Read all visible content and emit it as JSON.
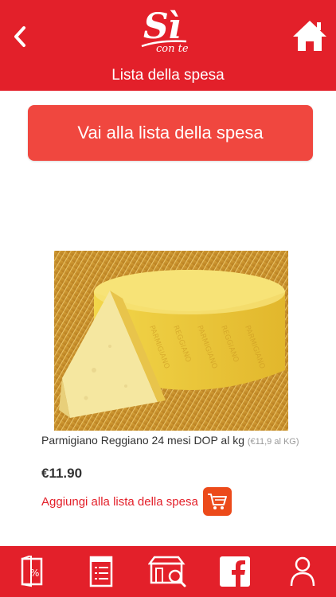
{
  "header": {
    "title": "Lista della spesa",
    "logo_main": "Sì",
    "logo_sub": "con te",
    "back_icon": "chevron-left-icon",
    "home_icon": "home-icon"
  },
  "main": {
    "goto_list_label": "Vai alla lista della spesa"
  },
  "product": {
    "name": "Parmigiano Reggiano 24 mesi DOP al kg",
    "unit_note": "(€11,9 al KG)",
    "price": "€11.90",
    "add_label": "Aggiungi alla lista della spesa",
    "cart_icon": "cart-icon"
  },
  "bottom_nav": {
    "items": [
      {
        "icon": "flyer-icon"
      },
      {
        "icon": "list-icon"
      },
      {
        "icon": "store-search-icon"
      },
      {
        "icon": "facebook-icon"
      },
      {
        "icon": "user-icon"
      }
    ]
  },
  "colors": {
    "brand_red": "#e3202a",
    "button_red": "#f0473f",
    "cart_orange": "#ec4a1a"
  }
}
